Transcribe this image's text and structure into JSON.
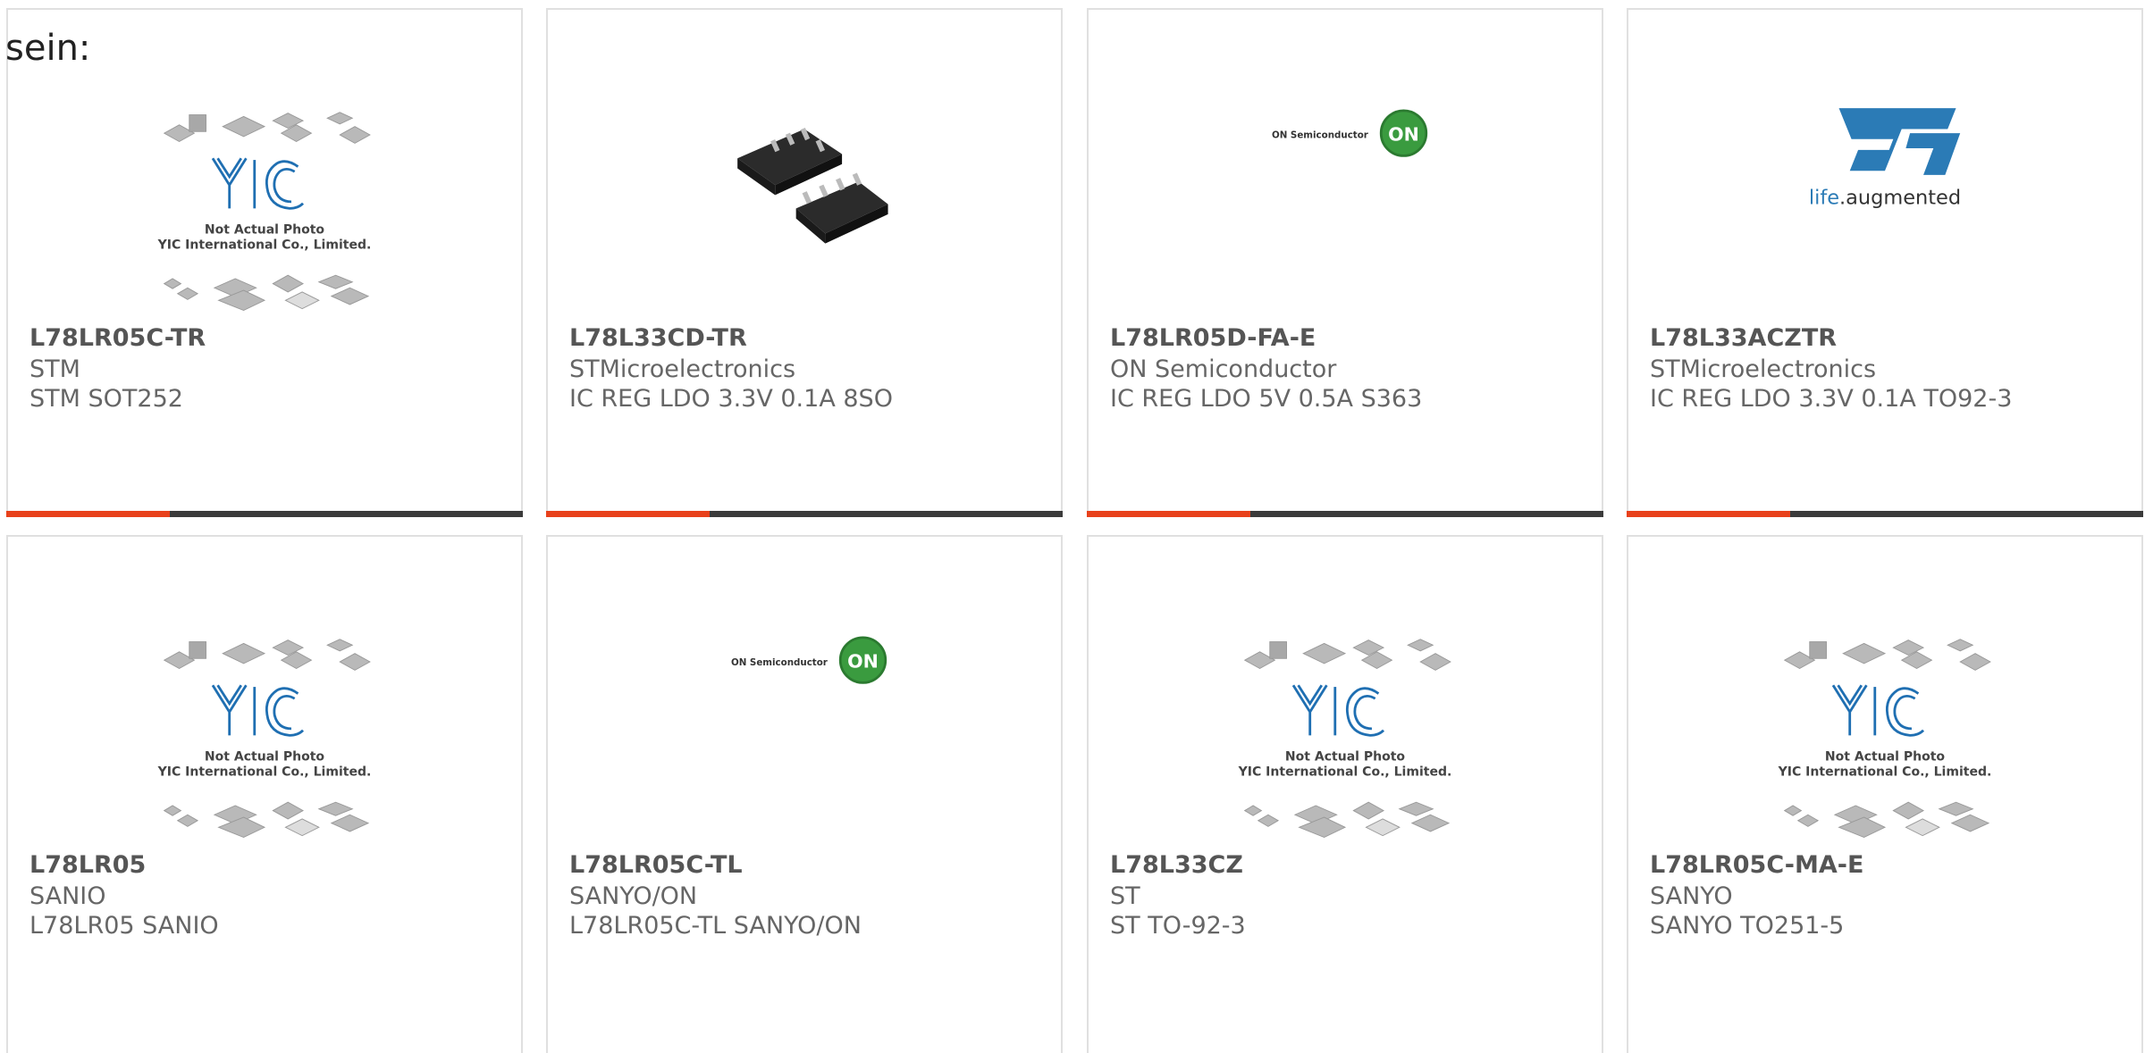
{
  "intro_text": "sein:",
  "colors": {
    "accent": "#e8411b",
    "bar": "#3b3b3b",
    "border": "#e0e0e0",
    "yic_blue": "#1f6fb2",
    "on_green": "#3a9b3f",
    "st_blue": "#2b7bb6"
  },
  "placeholder": {
    "line1": "Not Actual Photo",
    "line2": "YIC International Co., Limited.",
    "logo": "YIC"
  },
  "on_logo": {
    "text": "ON Semiconductor",
    "badge": "ON"
  },
  "st_logo": {
    "tagline_a": "life",
    "tagline_b": ".augmented"
  },
  "products": [
    {
      "part": "L78LR05C-TR",
      "maker": "STM",
      "desc": "STM SOT252",
      "image": "yic-placeholder"
    },
    {
      "part": "L78L33CD-TR",
      "maker": "STMicroelectronics",
      "desc": "IC REG LDO 3.3V 0.1A 8SO",
      "image": "chip-photo"
    },
    {
      "part": "L78LR05D-FA-E",
      "maker": "ON Semiconductor",
      "desc": "IC REG LDO 5V 0.5A S363",
      "image": "on-semiconductor-logo"
    },
    {
      "part": "L78L33ACZTR",
      "maker": "STMicroelectronics",
      "desc": "IC REG LDO 3.3V 0.1A TO92-3",
      "image": "st-logo"
    },
    {
      "part": "L78LR05",
      "maker": "SANIO",
      "desc": "L78LR05 SANIO",
      "image": "yic-placeholder"
    },
    {
      "part": "L78LR05C-TL",
      "maker": "SANYO/ON",
      "desc": "L78LR05C-TL SANYO/ON",
      "image": "on-semiconductor-logo"
    },
    {
      "part": "L78L33CZ",
      "maker": "ST",
      "desc": "ST TO-92-3",
      "image": "yic-placeholder"
    },
    {
      "part": "L78LR05C-MA-E",
      "maker": "SANYO",
      "desc": "SANYO TO251-5",
      "image": "yic-placeholder"
    }
  ]
}
